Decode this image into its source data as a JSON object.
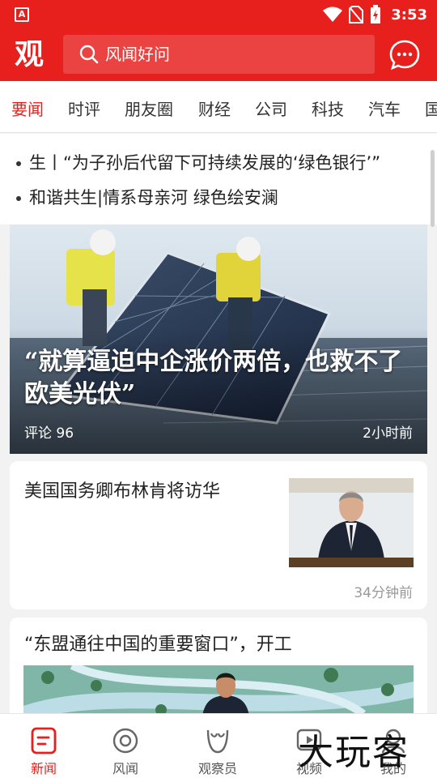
{
  "status_bar": {
    "time": "3:53",
    "left_icon_letter": "A"
  },
  "header": {
    "logo": "观",
    "search": {
      "placeholder": "风闻好问"
    },
    "chat_icon": "chat-bubble-icon"
  },
  "tabs": [
    {
      "label": "要闻",
      "active": true
    },
    {
      "label": "时评"
    },
    {
      "label": "朋友圈"
    },
    {
      "label": "财经"
    },
    {
      "label": "公司"
    },
    {
      "label": "科技"
    },
    {
      "label": "汽车"
    },
    {
      "label": "国"
    }
  ],
  "ticker": [
    "生丨“为子孙后代留下可持续发展的‘绿色银行’”",
    "和谐共生|情系母亲河 绿色绘安澜"
  ],
  "hero": {
    "title": "“就算逼迫中企涨价两倍，也救不了欧美光伏”",
    "comments": "评论 96",
    "time": "2小时前"
  },
  "articles": [
    {
      "title": "美国国务卿布林肯将访华",
      "time": "34分钟前"
    },
    {
      "title": "“东盟通往中国的重要窗口”，开工"
    }
  ],
  "bottom_nav": [
    {
      "label": "新闻",
      "icon": "news-icon",
      "active": true
    },
    {
      "label": "风闻",
      "icon": "fengwen-icon"
    },
    {
      "label": "观察员",
      "icon": "observer-icon"
    },
    {
      "label": "视频",
      "icon": "video-icon"
    },
    {
      "label": "我的",
      "icon": "profile-icon"
    }
  ],
  "watermark": "大玩客",
  "colors": {
    "brand": "#e8201d",
    "background": "#f2f2f2"
  }
}
